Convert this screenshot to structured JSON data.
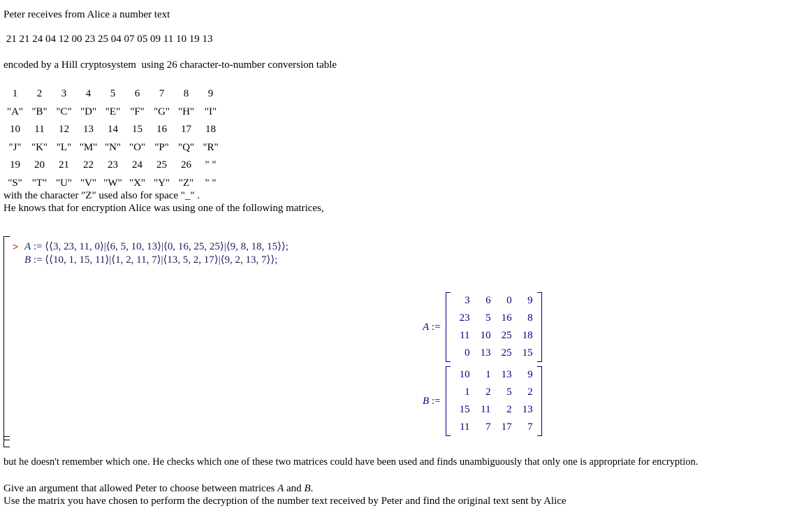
{
  "document": {
    "intro_line": "Peter receives from Alice a number text",
    "number_text": " 21 21 24 04 12 00 23 25 04 07 05 09 11 10 19 13",
    "encoding_line": "encoded by a Hill cryptosystem  using 26 character-to-number conversion table",
    "note_space": "with the character \"Z\" used also for space \"_\" .",
    "note_matrices": "He knows that for encryption Alice was using one of the following matrices,",
    "closing_line": "but he doesn't remember which one. He checks which one of these two matrices could have been used and finds unambiguously that only one is appropriate for encryption.",
    "task_1_pre": "Give an argument that allowed Peter to choose between matrices ",
    "task_1_var_a": "A",
    "task_1_mid": " and ",
    "task_1_var_b": "B",
    "task_1_post": ".",
    "task_2": "Use the matrix you have chosen to perform the decryption of the number text received by Peter and find the original text sent by Alice"
  },
  "conversion_table": {
    "rows": [
      [
        "1",
        "2",
        "3",
        "4",
        "5",
        "6",
        "7",
        "8",
        "9"
      ],
      [
        "\"A\"",
        "\"B\"",
        "\"C\"",
        "\"D\"",
        "\"E\"",
        "\"F\"",
        "\"G\"",
        "\"H\"",
        "\"I\""
      ],
      [
        "10",
        "11",
        "12",
        "13",
        "14",
        "15",
        "16",
        "17",
        "18"
      ],
      [
        "\"J\"",
        "\"K\"",
        "\"L\"",
        "\"M\"",
        "\"N\"",
        "\"O\"",
        "\"P\"",
        "\"Q\"",
        "\"R\""
      ],
      [
        "19",
        "20",
        "21",
        "22",
        "23",
        "24",
        "25",
        "26",
        "\" \""
      ],
      [
        "\"S\"",
        "\"T\"",
        "\"U\"",
        "\"V\"",
        "\"W\"",
        "\"X\"",
        "\"Y\"",
        "\"Z\"",
        "\" \""
      ]
    ]
  },
  "maple": {
    "prompt": ">",
    "prompt_color": "#b00000",
    "input_color": "#1a1a60",
    "output_color": "#000080",
    "input_A_var": "A",
    "input_A_expr": " := ⟨⟨3, 23, 11, 0⟩|⟨6, 5, 10, 13⟩|⟨0, 16, 25, 25⟩|⟨9, 8, 18, 15⟩⟩;",
    "input_B_var": "B",
    "input_B_expr": " := ⟨⟨10, 1, 15, 11⟩|⟨1, 2, 11, 7⟩|⟨13, 5, 2, 17⟩|⟨9, 2, 13, 7⟩⟩;",
    "output_A": {
      "label_var": "A",
      "label_assign": " :=",
      "matrix": [
        [
          "3",
          "6",
          "0",
          "9"
        ],
        [
          "23",
          "5",
          "16",
          "8"
        ],
        [
          "11",
          "10",
          "25",
          "18"
        ],
        [
          "0",
          "13",
          "25",
          "15"
        ]
      ]
    },
    "output_B": {
      "label_var": "B",
      "label_assign": " :=",
      "matrix": [
        [
          "10",
          "1",
          "13",
          "9"
        ],
        [
          "1",
          "2",
          "5",
          "2"
        ],
        [
          "15",
          "11",
          "2",
          "13"
        ],
        [
          "11",
          "7",
          "17",
          "7"
        ]
      ]
    }
  }
}
